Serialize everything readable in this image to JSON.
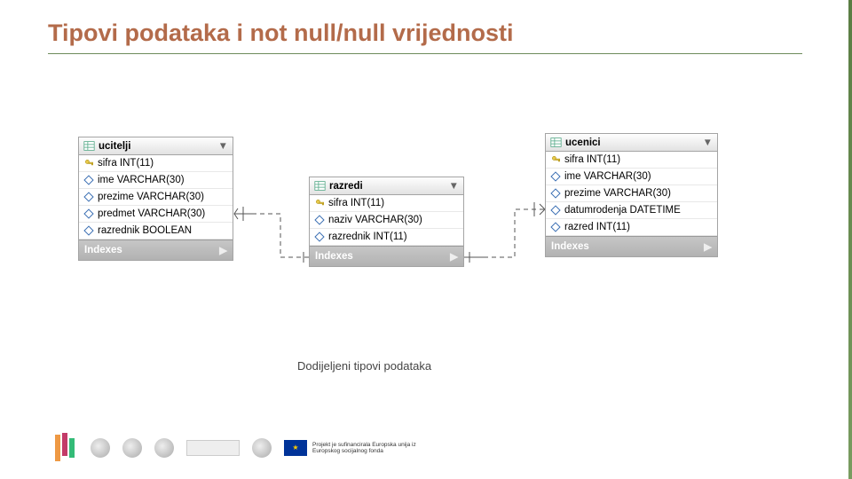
{
  "title": "Tipovi podataka i not null/null vrijednosti",
  "caption": "Dodijeljeni tipovi podataka",
  "indexes_label": "Indexes",
  "tables": {
    "ucitelji": {
      "name": "ucitelji",
      "columns": [
        {
          "label": "sifra INT(11)",
          "icon": "key"
        },
        {
          "label": "ime VARCHAR(30)",
          "icon": "diamond"
        },
        {
          "label": "prezime VARCHAR(30)",
          "icon": "diamond"
        },
        {
          "label": "predmet VARCHAR(30)",
          "icon": "diamond"
        },
        {
          "label": "razrednik BOOLEAN",
          "icon": "diamond"
        }
      ]
    },
    "razredi": {
      "name": "razredi",
      "columns": [
        {
          "label": "sifra INT(11)",
          "icon": "key"
        },
        {
          "label": "naziv VARCHAR(30)",
          "icon": "diamond"
        },
        {
          "label": "razrednik INT(11)",
          "icon": "diamond"
        }
      ]
    },
    "ucenici": {
      "name": "ucenici",
      "columns": [
        {
          "label": "sifra INT(11)",
          "icon": "key"
        },
        {
          "label": "ime VARCHAR(30)",
          "icon": "diamond"
        },
        {
          "label": "prezime VARCHAR(30)",
          "icon": "diamond"
        },
        {
          "label": "datumrodenja DATETIME",
          "icon": "diamond"
        },
        {
          "label": "razred INT(11)",
          "icon": "diamond"
        }
      ]
    }
  },
  "footer": {
    "eu_text": "Projekt je sufinancirala Europska unija iz Europskog socijalnog fonda"
  },
  "colors": {
    "title": "#b36b4a",
    "accent": "#6d8b5c",
    "indexes_bg": "#b9b9b9"
  }
}
